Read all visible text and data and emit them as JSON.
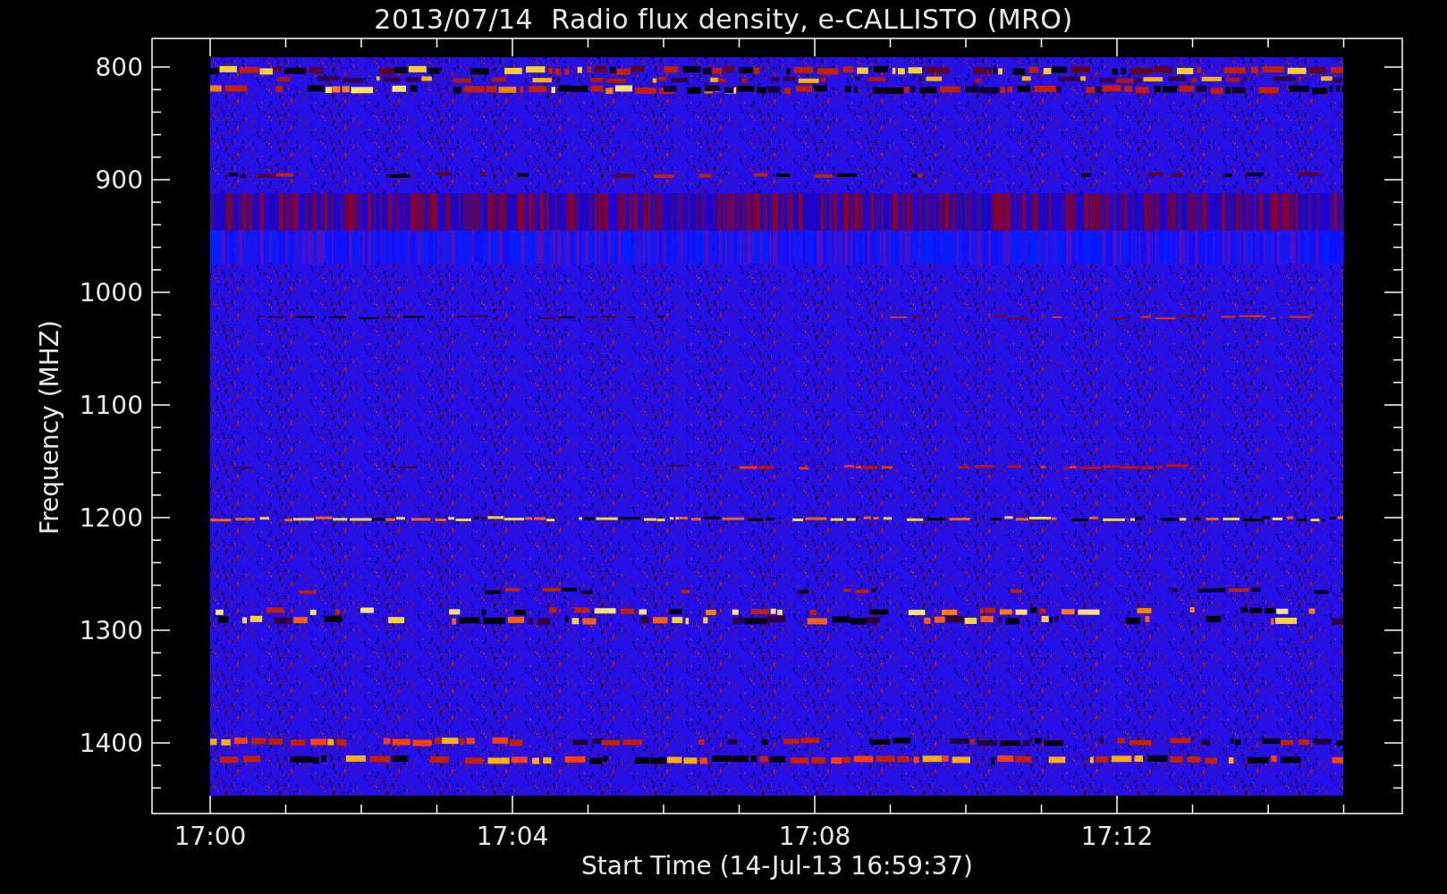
{
  "title": "2013/07/14  Radio flux density, e-CALLISTO (MRO)",
  "y_axis": {
    "title": "Frequency (MHZ)",
    "ticks": [
      "800",
      "900",
      "1000",
      "1100",
      "1200",
      "1300",
      "1400"
    ]
  },
  "x_axis": {
    "title": "Start Time (14-Jul-13 16:59:37)",
    "ticks": [
      "17:00",
      "17:04",
      "17:08",
      "17:12"
    ]
  }
}
